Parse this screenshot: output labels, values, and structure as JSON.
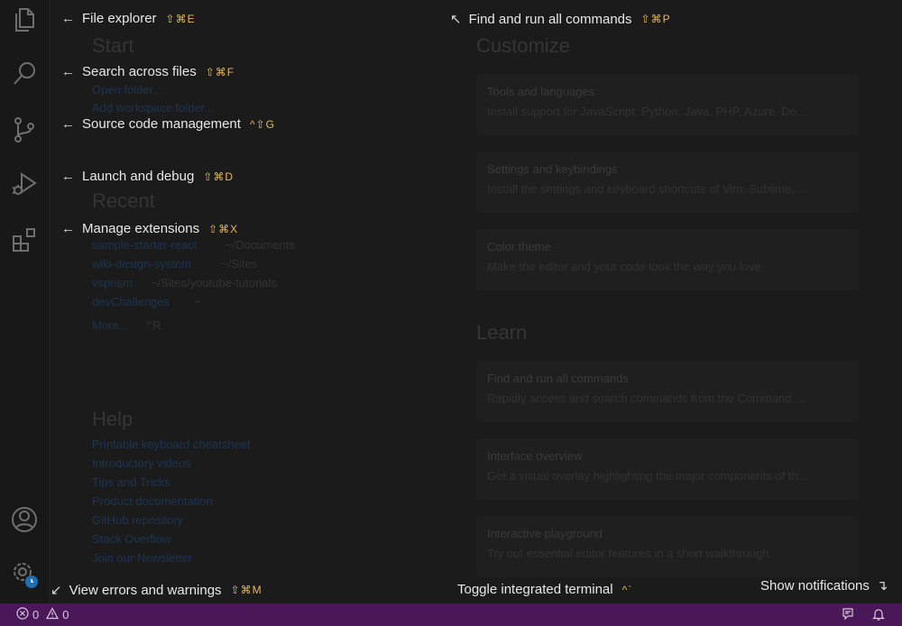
{
  "hints": {
    "file_explorer": {
      "label": "File explorer",
      "keys": "⇧⌘E"
    },
    "search": {
      "label": "Search across files",
      "keys": "⇧⌘F"
    },
    "source_control": {
      "label": "Source code management",
      "keys": "^⇧G"
    },
    "debug": {
      "label": "Launch and debug",
      "keys": "⇧⌘D"
    },
    "extensions": {
      "label": "Manage extensions",
      "keys": "⇧⌘X"
    },
    "commands": {
      "label": "Find and run all commands",
      "keys": "⇧⌘P"
    },
    "problems": {
      "label": "View errors and warnings",
      "keys": "⇧⌘M"
    },
    "terminal": {
      "label": "Toggle integrated terminal",
      "keys": "^`"
    },
    "notifications": {
      "label": "Show notifications"
    }
  },
  "background": {
    "start_heading": "Start",
    "start_links": [
      "Open folder...",
      "Add workspace folder..."
    ],
    "recent_heading": "Recent",
    "recent_items": [
      {
        "name": "sample-starter-react",
        "path": "~/Documents"
      },
      {
        "name": "wiki-design-system",
        "path": "~/Sites"
      },
      {
        "name": "vsprism",
        "path": "~/Sites/youtube-tutorials"
      },
      {
        "name": "devChallenges",
        "path": "~"
      }
    ],
    "recent_more": "More...",
    "recent_more_keys": "^R",
    "help_heading": "Help",
    "help_links": [
      "Printable keyboard cheatsheet",
      "Introductory videos",
      "Tips and Tricks",
      "Product documentation",
      "GitHub repository",
      "Stack Overflow",
      "Join our Newsletter"
    ],
    "customize_heading": "Customize",
    "customize_cards": [
      {
        "title": "Tools and languages",
        "desc": "Install support for JavaScript, Python, Java, PHP, Azure, Do..."
      },
      {
        "title": "Settings and keybindings",
        "desc": "Install the settings and keyboard shortcuts of Vim, Sublime, ..."
      },
      {
        "title": "Color theme",
        "desc": "Make the editor and your code look the way you love"
      }
    ],
    "learn_heading": "Learn",
    "learn_cards": [
      {
        "title": "Find and run all commands",
        "desc": "Rapidly access and search commands from the Command ..."
      },
      {
        "title": "Interface overview",
        "desc": "Get a visual overlay highlighting the major components of th..."
      },
      {
        "title": "Interactive playground",
        "desc": "Try out essential editor features in a short walkthrough"
      }
    ]
  },
  "status": {
    "errors": "0",
    "warnings": "0"
  },
  "colors": {
    "accent_keys": "#e5b95c",
    "status_bar": "#4a1858"
  }
}
